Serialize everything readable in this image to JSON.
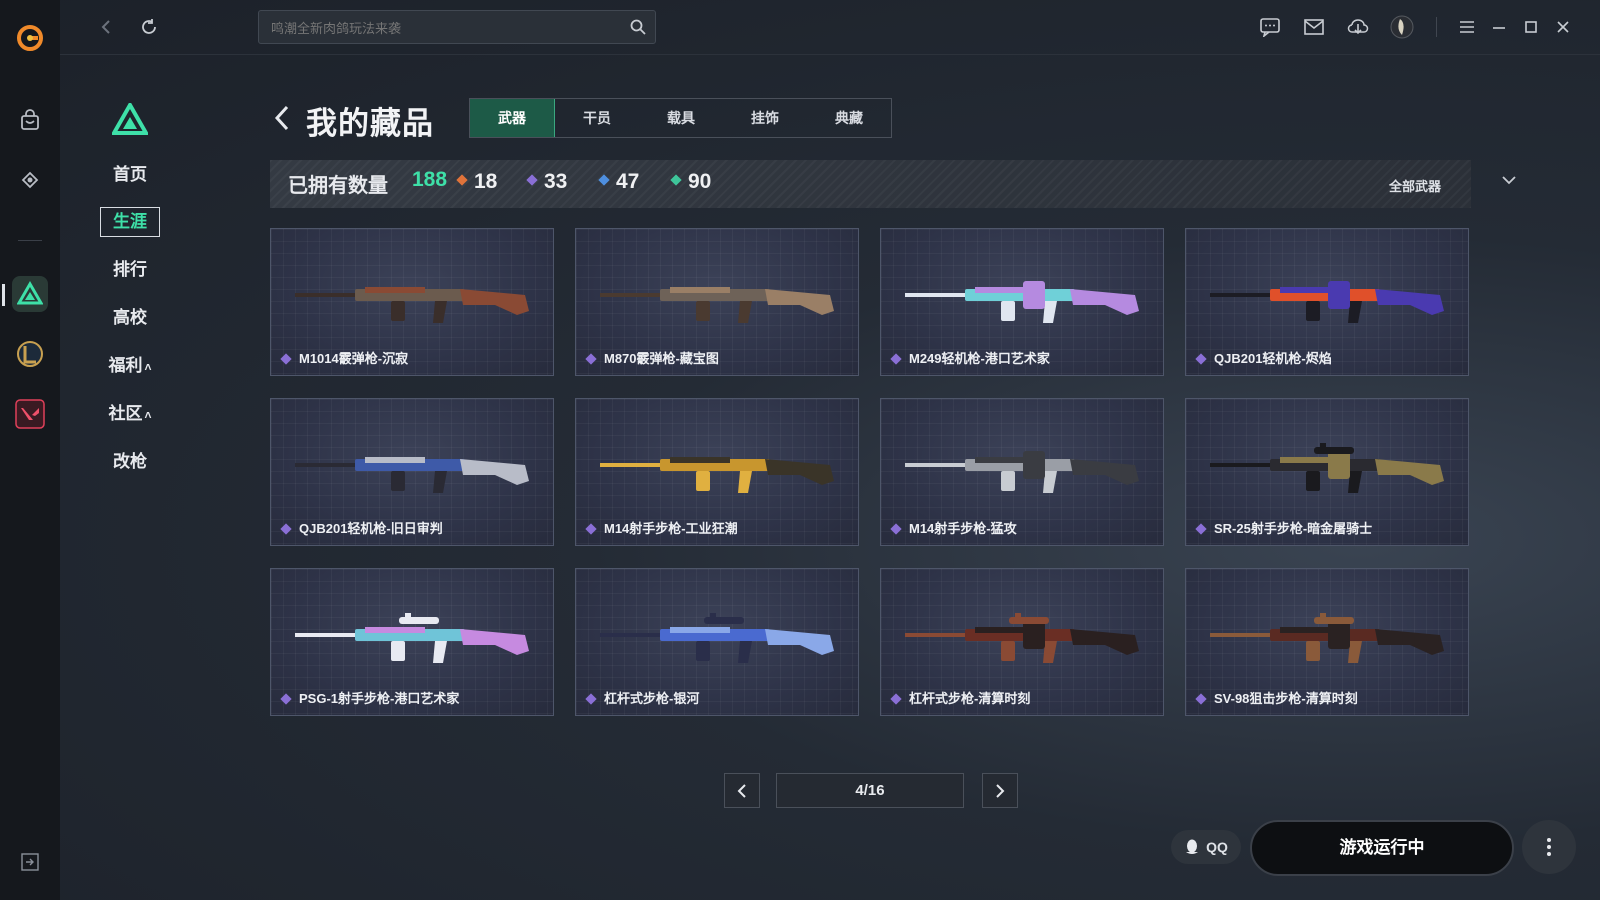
{
  "topbar": {
    "search_placeholder": "鸣潮全新肉鸽玩法来袭"
  },
  "nav": {
    "items": [
      {
        "label": "首页",
        "active": false
      },
      {
        "label": "生涯",
        "active": true
      },
      {
        "label": "排行",
        "active": false
      },
      {
        "label": "高校",
        "active": false
      },
      {
        "label": "福利",
        "active": false
      },
      {
        "label": "社区",
        "active": false
      },
      {
        "label": "改枪",
        "active": false
      }
    ],
    "caret": "˄"
  },
  "header": {
    "title": "我的藏品",
    "tabs": [
      "武器",
      "干员",
      "载具",
      "挂饰",
      "典藏"
    ],
    "active_tab": "武器"
  },
  "stats": {
    "owned_label": "已拥有数量",
    "owned_count": "188",
    "rarities": [
      {
        "value": "18",
        "color": "#e0733a"
      },
      {
        "value": "33",
        "color": "#8a6fd6"
      },
      {
        "value": "47",
        "color": "#4e8fe0"
      },
      {
        "value": "90",
        "color": "#3ec59a"
      }
    ],
    "filter_label": "全部武器"
  },
  "items": [
    {
      "name": "M1014霰弹枪-沉寂",
      "palette": [
        "#6b5b4e",
        "#8a4a34",
        "#3a2e2a"
      ]
    },
    {
      "name": "M870霰弹枪-藏宝图",
      "palette": [
        "#6e6258",
        "#9a7f66",
        "#4a3a30"
      ]
    },
    {
      "name": "M249轻机枪-港口艺术家",
      "palette": [
        "#6fd0d8",
        "#b58ae0",
        "#e0e6f0"
      ]
    },
    {
      "name": "QJB201轻机枪-烬焰",
      "palette": [
        "#e0502a",
        "#4a3ab0",
        "#1c1c24"
      ]
    },
    {
      "name": "QJB201轻机枪-旧日审判",
      "palette": [
        "#3e5aa8",
        "#b8bcc8",
        "#2a2a34"
      ]
    },
    {
      "name": "M14射手步枪-工业狂潮",
      "palette": [
        "#c8962e",
        "#3a3428",
        "#e0b040"
      ]
    },
    {
      "name": "M14射手步枪-猛攻",
      "palette": [
        "#9a9ea6",
        "#3a3c42",
        "#c8ccd2"
      ]
    },
    {
      "name": "SR-25射手步枪-暗金屠骑士",
      "palette": [
        "#2a2a30",
        "#8a7a4a",
        "#1a1a1e"
      ]
    },
    {
      "name": "PSG-1射手步枪-港口艺术家",
      "palette": [
        "#6fc4d8",
        "#c68ae0",
        "#e8eaf2"
      ]
    },
    {
      "name": "杠杆式步枪-银河",
      "palette": [
        "#4a6ad0",
        "#8aa8e8",
        "#2a2e4a"
      ]
    },
    {
      "name": "杠杆式步枪-清算时刻",
      "palette": [
        "#6a2e24",
        "#2a2020",
        "#8a4a34"
      ]
    },
    {
      "name": "SV-98狙击步枪-清算时刻",
      "palette": [
        "#5a2a22",
        "#2a2222",
        "#8a5a3a"
      ]
    }
  ],
  "pagination": {
    "page_text": "4/16"
  },
  "footer": {
    "qq_label": "QQ",
    "run_label": "游戏运行中"
  },
  "colors": {
    "accent": "#3ee0a8",
    "tab_active_bg": "#1d5a47"
  }
}
